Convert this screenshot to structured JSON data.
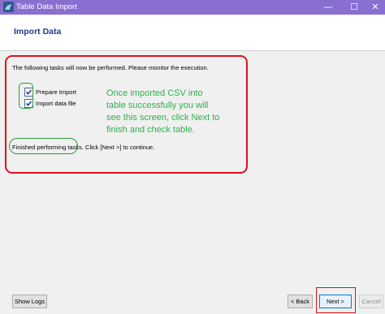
{
  "window": {
    "title": "Table Data Import",
    "minimize_glyph": "—",
    "maximize_glyph": "☐",
    "close_glyph": "✕",
    "title_bar_color": "#8a6fd1"
  },
  "header": {
    "title": "Import Data"
  },
  "main": {
    "intro": "The following tasks will now be performed. Please monitor the execution.",
    "tasks": [
      {
        "label": "Prepare Import",
        "checked": true
      },
      {
        "label": "Import data file",
        "checked": true
      }
    ],
    "status": "Finished performing tasks. Click [Next >] to continue."
  },
  "annotation": {
    "text": "Once imported CSV into table successfully you will see this screen, click Next to finish and check table.",
    "color": "#2bb24c"
  },
  "footer": {
    "show_logs": "Show Logs",
    "back": "< Back",
    "next": "Next >",
    "cancel": "Cancel"
  },
  "icons": {
    "app": "workbench-dolphin-icon",
    "check": "checkmark-icon"
  }
}
